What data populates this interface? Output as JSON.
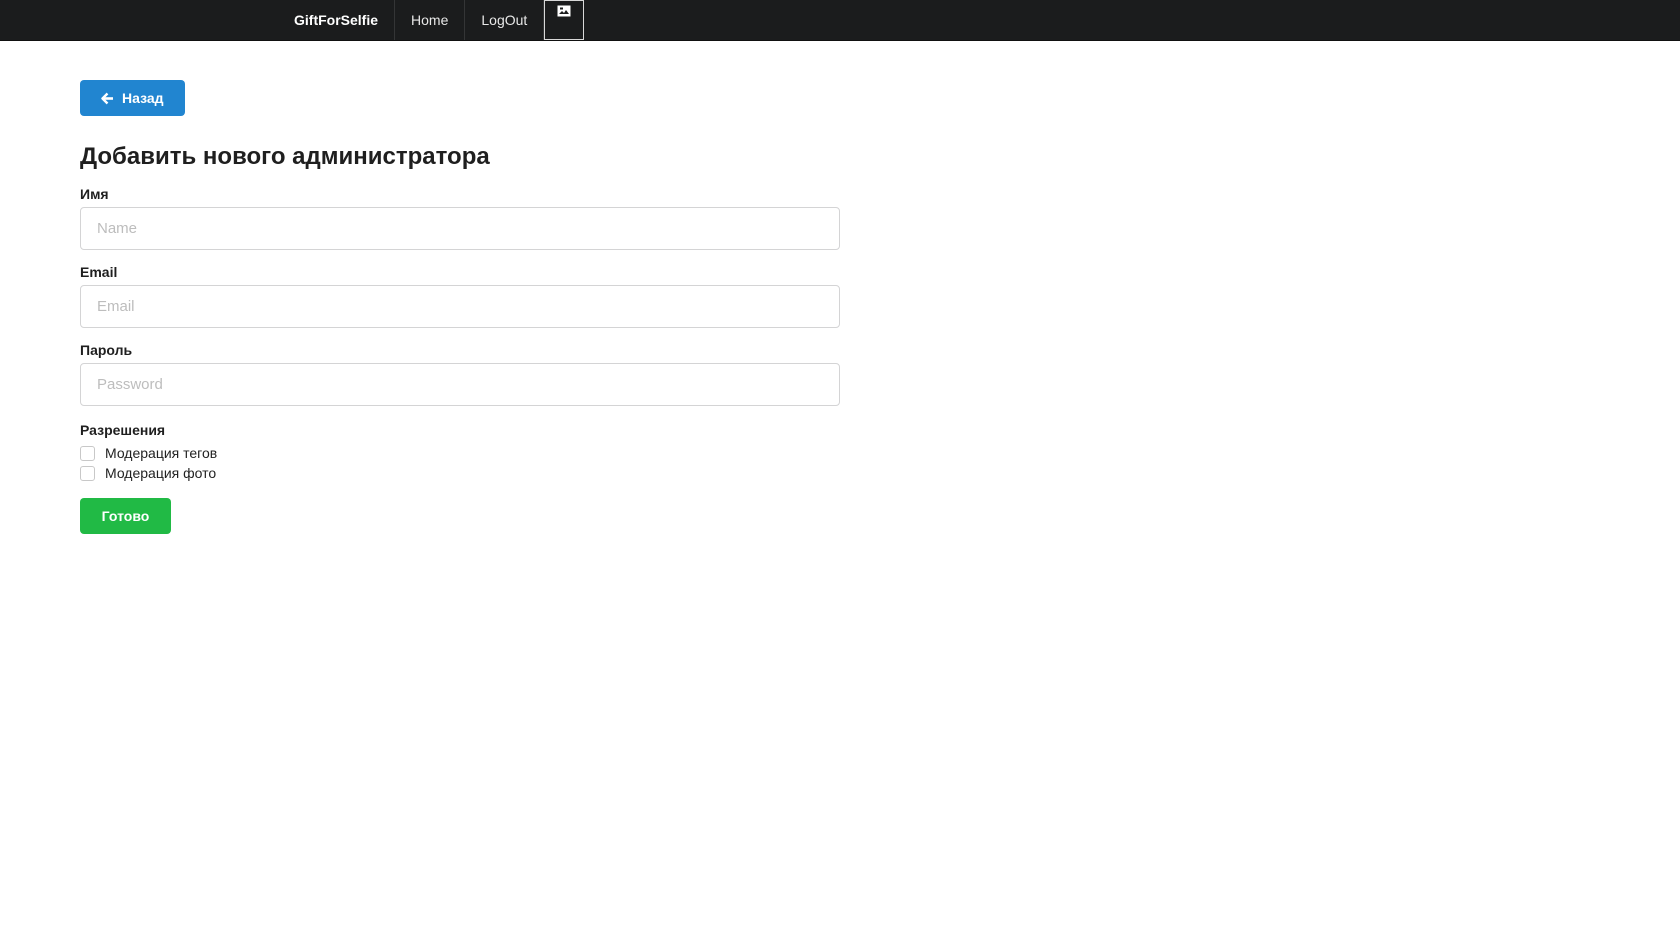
{
  "navbar": {
    "brand": "GiftForSelfie",
    "items": [
      {
        "label": "Home"
      },
      {
        "label": "LogOut"
      }
    ],
    "image_icon": "broken-image-icon"
  },
  "back_button": {
    "label": "Назад",
    "icon": "arrow-left-icon"
  },
  "page": {
    "title": "Добавить нового администратора"
  },
  "form": {
    "name": {
      "label": "Имя",
      "placeholder": "Name",
      "value": ""
    },
    "email": {
      "label": "Email",
      "placeholder": "Email",
      "value": ""
    },
    "password": {
      "label": "Пароль",
      "placeholder": "Password",
      "value": ""
    },
    "permissions": {
      "label": "Разрешения",
      "options": [
        {
          "label": "Модерация тегов",
          "checked": false
        },
        {
          "label": "Модерация фото",
          "checked": false
        }
      ]
    },
    "submit_label": "Готово"
  },
  "colors": {
    "navbar_bg": "#1b1c1d",
    "primary": "#2185d0",
    "success": "#21ba45"
  }
}
